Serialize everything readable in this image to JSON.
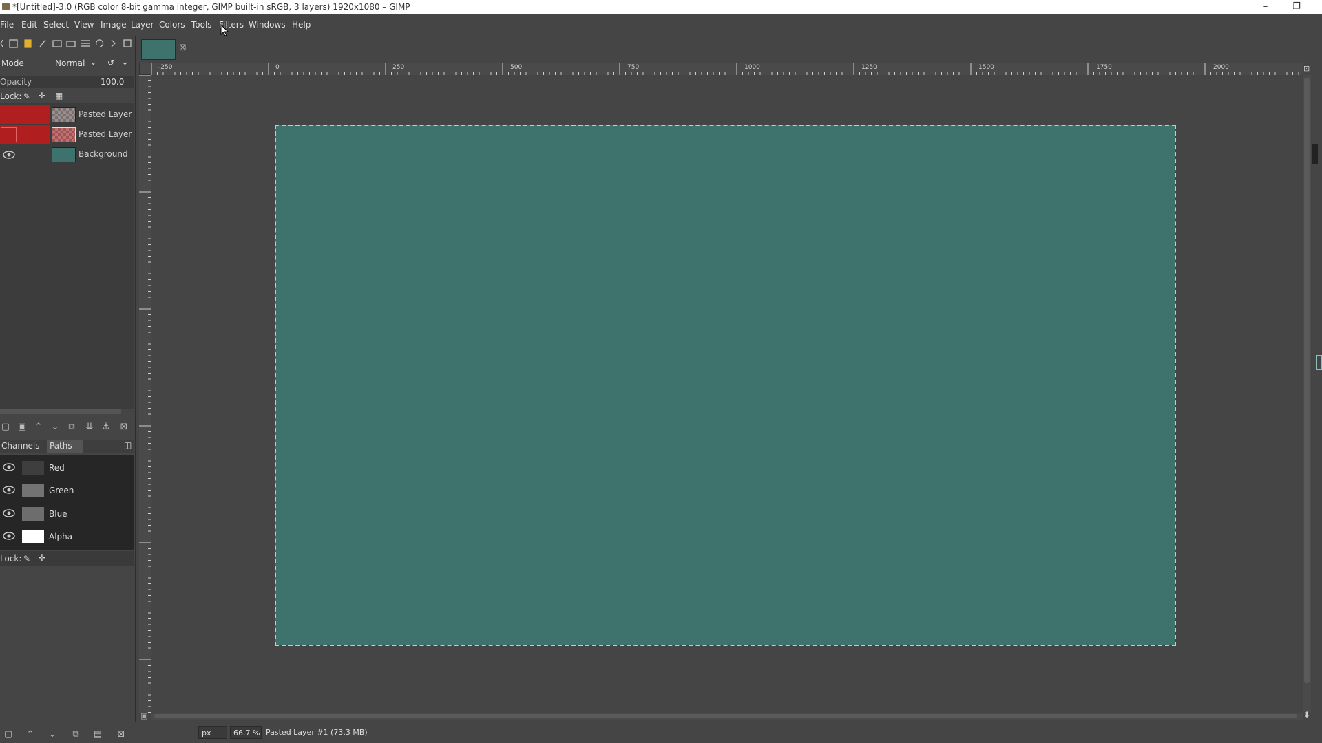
{
  "window": {
    "title": "*[Untitled]-3.0 (RGB color 8-bit gamma integer, GIMP built-in sRGB, 3 layers) 1920x1080 – GIMP",
    "minimize": "–",
    "restore": "❐"
  },
  "menubar": [
    "File",
    "Edit",
    "Select",
    "View",
    "Image",
    "Layer",
    "Colors",
    "Tools",
    "Filters",
    "Windows",
    "Help"
  ],
  "layers_panel": {
    "mode_label": "Mode",
    "mode_value": "Normal",
    "opacity_label": "Opacity",
    "opacity_value": "100.0",
    "lock_label": "Lock:",
    "layers": [
      {
        "name": "Pasted Layer",
        "visible": false,
        "selected": true
      },
      {
        "name": "Pasted Layer",
        "visible": false,
        "selected": true
      },
      {
        "name": "Background",
        "visible": true,
        "selected": false
      }
    ]
  },
  "channels_panel": {
    "tab_channels": "Channels",
    "tab_paths": "Paths",
    "channels": [
      {
        "name": "Red"
      },
      {
        "name": "Green"
      },
      {
        "name": "Blue"
      },
      {
        "name": "Alpha"
      }
    ],
    "lock_label": "Lock:"
  },
  "rulers": {
    "horizontal": [
      "-250",
      "0",
      "250",
      "500",
      "750",
      "1000",
      "1250",
      "1500",
      "1750",
      "2000"
    ]
  },
  "status": {
    "unit": "px",
    "zoom": "66.7 %",
    "message": "Pasted Layer #1 (73.3 MB)"
  },
  "colors": {
    "canvas_fill": "#3e736d",
    "selected_layer": "#b01e20",
    "selection_outline": "#d8d46a"
  }
}
